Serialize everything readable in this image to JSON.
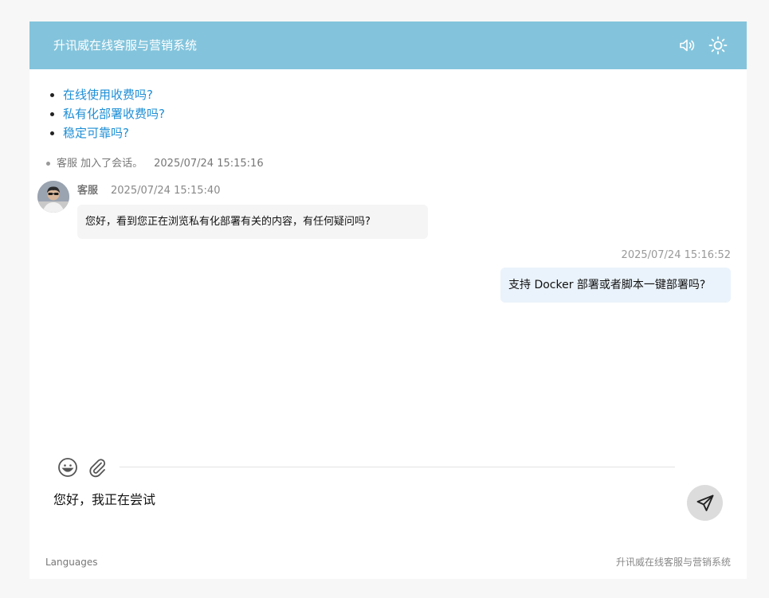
{
  "header": {
    "title": "升讯威在线客服与营销系统",
    "sound_icon": "speaker-icon",
    "theme_icon": "sun-icon"
  },
  "faq": {
    "items": [
      {
        "label": "在线使用收费吗?"
      },
      {
        "label": "私有化部署收费吗?"
      },
      {
        "label": "稳定可靠吗?"
      }
    ]
  },
  "conversation": {
    "system_message": {
      "text": "客服 加入了会话。",
      "time": "2025/07/24 15:15:16"
    },
    "agent_message": {
      "name": "客服",
      "time": "2025/07/24 15:15:40",
      "text": "您好，看到您正在浏览私有化部署有关的内容，有任何疑问吗?"
    },
    "user_message": {
      "time": "2025/07/24 15:16:52",
      "text": "支持 Docker 部署或者脚本一键部署吗?"
    }
  },
  "composer": {
    "emoji_icon": "smiley-icon",
    "attach_icon": "paperclip-icon",
    "input_value": "您好，我正在尝试",
    "send_icon": "paper-plane-icon"
  },
  "footer": {
    "languages_label": "Languages",
    "brand": "升讯威在线客服与营销系统"
  },
  "colors": {
    "header_bg": "#83c4dc",
    "link": "#1f8fd6",
    "agent_bubble": "#f5f5f5",
    "user_bubble": "#eaf3fb",
    "send_button": "#dcdcdc"
  }
}
